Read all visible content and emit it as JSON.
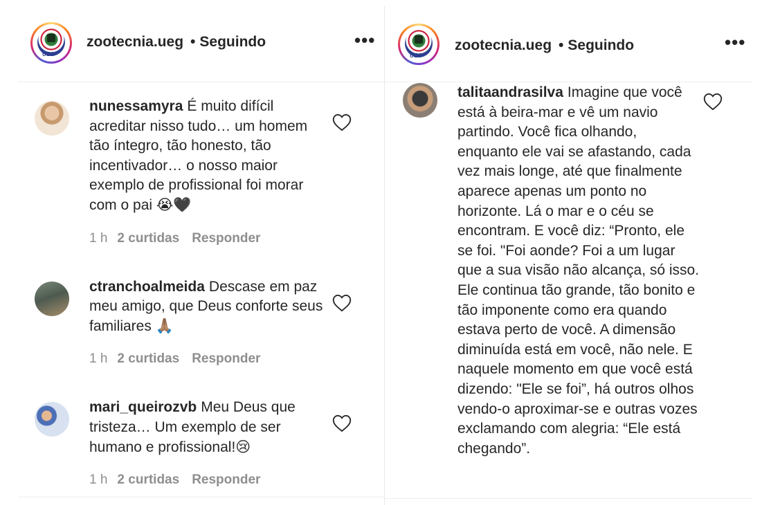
{
  "left_panel": {
    "account": "zootecnia.ueg",
    "separator": "•",
    "follow_status": "Seguindo",
    "logo_text": "UEG",
    "more": "•••",
    "comments": [
      {
        "username": "nunessamyra",
        "text": "É muito difícil acreditar nisso tudo… um homem tão íntegro, tão honesto, tão incentivador… o nosso maior exemplo de profissional foi morar com o pai 😭🖤",
        "time": "1 h",
        "likes": "2 curtidas",
        "reply": "Responder"
      },
      {
        "username": "ctranchoalmeida",
        "text": "Descase em paz meu amigo, que Deus conforte seus familiares 🙏🏽",
        "time": "1 h",
        "likes": "2 curtidas",
        "reply": "Responder"
      },
      {
        "username": "mari_queirozvb",
        "text": "Meu Deus que tristeza… Um exemplo de ser humano e profissional!😢",
        "time": "1 h",
        "likes": "2 curtidas",
        "reply": "Responder"
      }
    ]
  },
  "right_panel": {
    "account": "zootecnia.ueg",
    "separator": "•",
    "follow_status": "Seguindo",
    "logo_text": "UEG",
    "more": "•••",
    "comment": {
      "username": "talitaandrasilva",
      "text": "Imagine que você está à beira-mar e vê um navio partindo. Você fica olhando, enquanto ele vai se afastando, cada vez mais longe, até que finalmente aparece apenas um ponto no horizonte. Lá o mar e o céu se encontram. E você diz: “Pronto, ele se foi. \"Foi aonde? Foi a um lugar que a sua visão não alcança, só isso. Ele continua tão grande, tão bonito e tão imponente como era quando estava perto de você. A dimensão diminuída está em você, não nele. E naquele momento em que você está dizendo: \"Ele se foi”, há outros olhos vendo-o aproximar-se e outras vozes exclamando com alegria: “Ele está chegando”."
    }
  }
}
